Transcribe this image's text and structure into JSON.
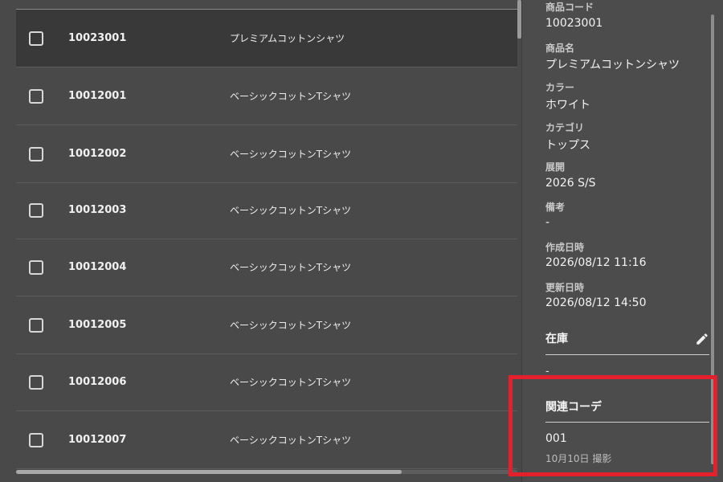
{
  "table": {
    "rows": [
      {
        "code": "10023001",
        "name": "プレミアムコットンシャツ",
        "selected": true
      },
      {
        "code": "10012001",
        "name": "ベーシックコットンTシャツ",
        "selected": false
      },
      {
        "code": "10012002",
        "name": "ベーシックコットンTシャツ",
        "selected": false
      },
      {
        "code": "10012003",
        "name": "ベーシックコットンTシャツ",
        "selected": false
      },
      {
        "code": "10012004",
        "name": "ベーシックコットンTシャツ",
        "selected": false
      },
      {
        "code": "10012005",
        "name": "ベーシックコットンTシャツ",
        "selected": false
      },
      {
        "code": "10012006",
        "name": "ベーシックコットンTシャツ",
        "selected": false
      },
      {
        "code": "10012007",
        "name": "ベーシックコットンTシャツ",
        "selected": false
      }
    ]
  },
  "detail": {
    "fields": [
      {
        "label": "商品コード",
        "value": "10023001"
      },
      {
        "label": "商品名",
        "value": "プレミアムコットンシャツ"
      },
      {
        "label": "カラー",
        "value": "ホワイト"
      },
      {
        "label": "カテゴリ",
        "value": "トップス"
      },
      {
        "label": "展開",
        "value": "2026 S/S"
      },
      {
        "label": "備考",
        "value": "-"
      },
      {
        "label": "作成日時",
        "value": "2026/08/12 11:16"
      },
      {
        "label": "更新日時",
        "value": "2026/08/12 14:50"
      }
    ],
    "stock": {
      "title": "在庫",
      "value": "-"
    },
    "related": {
      "title": "関連コーデ",
      "code": "001",
      "note": "10月10日 撮影"
    }
  },
  "colors": {
    "highlight": "#e3202b",
    "panel_bg": "#4d4c4c",
    "table_bg": "#4a4949",
    "selected_row": "#3a3939"
  }
}
